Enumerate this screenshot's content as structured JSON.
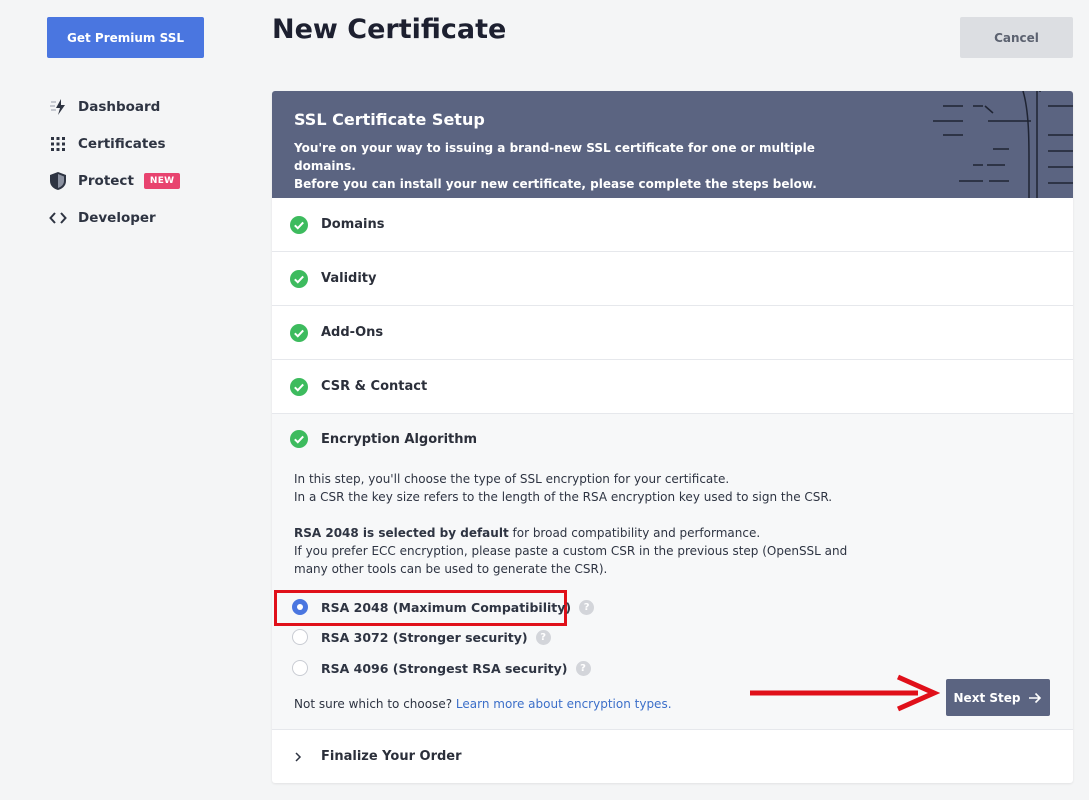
{
  "sidebar": {
    "premium_button": "Get Premium SSL",
    "items": [
      {
        "label": "Dashboard",
        "icon": "dashboard-icon"
      },
      {
        "label": "Certificates",
        "icon": "grid-icon"
      },
      {
        "label": "Protect",
        "icon": "shield-icon",
        "badge": "NEW"
      },
      {
        "label": "Developer",
        "icon": "code-icon"
      }
    ]
  },
  "header": {
    "title": "New Certificate",
    "cancel_label": "Cancel"
  },
  "hero": {
    "title": "SSL Certificate Setup",
    "desc_line1": "You're on your way to issuing a brand-new SSL certificate for one or multiple domains.",
    "desc_line2": "Before you can install your new certificate, please complete the steps below."
  },
  "steps": {
    "completed": [
      "Domains",
      "Validity",
      "Add-Ons",
      "CSR & Contact"
    ],
    "active": "Encryption Algorithm",
    "final": "Finalize Your Order"
  },
  "encryption": {
    "para1_line1": "In this step, you'll choose the type of SSL encryption for your certificate.",
    "para1_line2": "In a CSR the key size refers to the length of the RSA encryption key used to sign the CSR.",
    "para2_bold": "RSA 2048 is selected by default",
    "para2_rest": " for broad compatibility and performance.",
    "para2_line2": "If you prefer ECC encryption, please paste a custom CSR in the previous step (OpenSSL and",
    "para2_line3": "many other tools can be used to generate the CSR).",
    "options": [
      {
        "label": "RSA 2048 (Maximum Compatibility)",
        "selected": true
      },
      {
        "label": "RSA 3072 (Stronger security)",
        "selected": false
      },
      {
        "label": "RSA 4096 (Strongest RSA security)",
        "selected": false
      }
    ],
    "hint_text": "Not sure which to choose? ",
    "hint_link": "Learn more about encryption types.",
    "next_label": "Next Step"
  },
  "colors": {
    "accent": "#4a76e0",
    "hero": "#5b6481",
    "success": "#3dbb5e",
    "annotation": "#e0101a"
  }
}
